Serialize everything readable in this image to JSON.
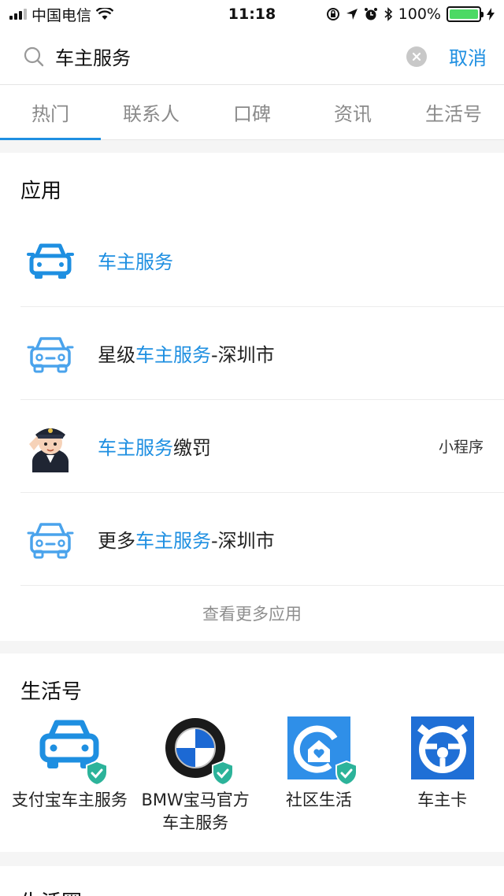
{
  "status_bar": {
    "carrier": "中国电信",
    "time": "11:18",
    "battery": "100%"
  },
  "search": {
    "value": "车主服务",
    "cancel_label": "取消"
  },
  "tabs": [
    {
      "label": "热门",
      "active": true
    },
    {
      "label": "联系人"
    },
    {
      "label": "口碑"
    },
    {
      "label": "资讯"
    },
    {
      "label": "生活号"
    }
  ],
  "apps_section": {
    "title": "应用",
    "items": [
      {
        "pre": "",
        "hl": "车主服务",
        "post": "",
        "tag": "",
        "icon": "car-icon"
      },
      {
        "pre": "星级",
        "hl": "车主服务",
        "post": "-深圳市",
        "tag": "",
        "icon": "car-icon"
      },
      {
        "pre": "",
        "hl": "车主服务",
        "post": "缴罚",
        "tag": "小程序",
        "icon": "police-avatar-icon"
      },
      {
        "pre": "更多",
        "hl": "车主服务",
        "post": "-深圳市",
        "tag": "",
        "icon": "car-icon"
      }
    ],
    "more_label": "查看更多应用"
  },
  "life_section": {
    "title": "生活号",
    "items": [
      {
        "label": "支付宝车主服务",
        "icon": "car-icon",
        "verified": true
      },
      {
        "label": "BMW宝马官方车主服务",
        "icon": "bmw-logo-icon",
        "verified": true
      },
      {
        "label": "社区生活",
        "icon": "house-icon",
        "verified": true
      },
      {
        "label": "车主卡",
        "icon": "steering-wheel-icon",
        "verified": false
      }
    ]
  },
  "circle_section": {
    "title": "生活圈"
  },
  "colors": {
    "accent": "#1e8fe1",
    "shield": "#2cb39a"
  }
}
